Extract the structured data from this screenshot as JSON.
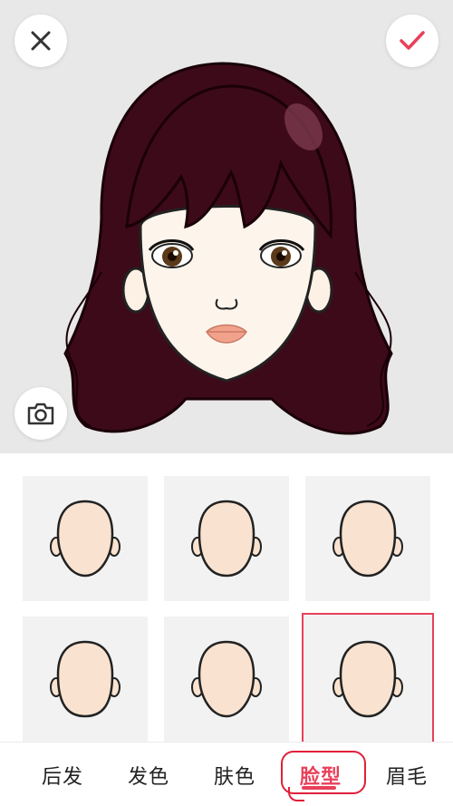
{
  "toolbar": {
    "close_icon": "close-icon",
    "confirm_icon": "check-icon",
    "camera_icon": "camera-icon"
  },
  "face_grid": {
    "options": [
      {
        "id": "face-1",
        "selected": false
      },
      {
        "id": "face-2",
        "selected": false
      },
      {
        "id": "face-3",
        "selected": false
      },
      {
        "id": "face-4",
        "selected": false
      },
      {
        "id": "face-5",
        "selected": false
      },
      {
        "id": "face-6",
        "selected": true
      }
    ]
  },
  "tabs": [
    {
      "label": "后发"
    },
    {
      "label": "发色"
    },
    {
      "label": "肤色"
    },
    {
      "label": "脸型",
      "active": true
    },
    {
      "label": "眉毛"
    }
  ],
  "colors": {
    "accent": "#e8405a",
    "hair": "#3d0a19",
    "skin": "#f9e3d0",
    "background": "#e8e8e8"
  }
}
